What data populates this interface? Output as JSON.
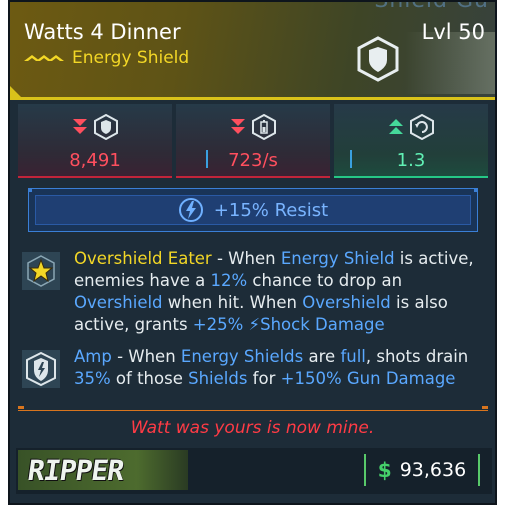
{
  "item": {
    "name": "Watts 4 Dinner",
    "level": "Lvl 50",
    "type": "Energy Shield",
    "header_bg_text": "Shield Gu",
    "rarity_color": "#f3d726"
  },
  "stats": [
    {
      "value": "8,491",
      "icon": "shield-capacity-icon",
      "trend": "down",
      "color": "#ff4f5e"
    },
    {
      "value": "723/s",
      "icon": "recharge-rate-icon",
      "trend": "down",
      "color": "#ff4f5e"
    },
    {
      "value": "1.3",
      "icon": "recharge-delay-icon",
      "trend": "up",
      "color": "#61f1b5"
    }
  ],
  "resist": {
    "label": "+15% Resist",
    "icon": "shock-element-icon"
  },
  "perks": [
    {
      "icon": "star-badge-icon",
      "segments": [
        {
          "t": "Overshield Eater",
          "c": "y"
        },
        {
          "t": " - When ",
          "c": ""
        },
        {
          "t": "Energy Shield",
          "c": "b"
        },
        {
          "t": " is active, enemies have a ",
          "c": ""
        },
        {
          "t": "12%",
          "c": "b"
        },
        {
          "t": " chance to drop an ",
          "c": ""
        },
        {
          "t": "Overshield",
          "c": "b"
        },
        {
          "t": " when hit. When ",
          "c": ""
        },
        {
          "t": "Overshield",
          "c": "b"
        },
        {
          "t": " is also active, grants ",
          "c": ""
        },
        {
          "t": "+25% ",
          "c": "b"
        },
        {
          "t": "⚡",
          "c": "b"
        },
        {
          "t": "Shock Damage",
          "c": "b"
        }
      ]
    },
    {
      "icon": "amp-shield-icon",
      "segments": [
        {
          "t": "Amp",
          "c": "b"
        },
        {
          "t": " - When ",
          "c": ""
        },
        {
          "t": "Energy Shields",
          "c": "b"
        },
        {
          "t": " are ",
          "c": ""
        },
        {
          "t": "full",
          "c": "b"
        },
        {
          "t": ", shots drain ",
          "c": ""
        },
        {
          "t": "35%",
          "c": "b"
        },
        {
          "t": " of those ",
          "c": ""
        },
        {
          "t": "Shields",
          "c": "b"
        },
        {
          "t": " for ",
          "c": ""
        },
        {
          "t": "+150% Gun Damage",
          "c": "b"
        }
      ]
    }
  ],
  "flavor_text": "Watt was yours is now mine.",
  "manufacturer": "RIPPER",
  "price": {
    "currency": "$",
    "amount": "93,636"
  }
}
